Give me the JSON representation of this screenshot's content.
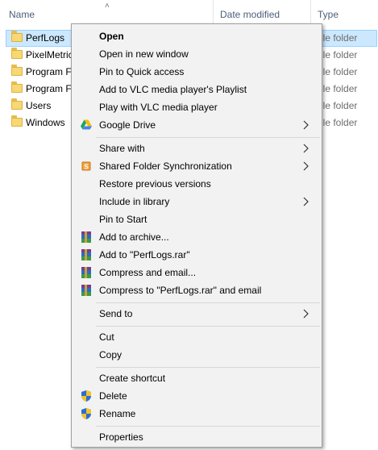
{
  "columns": {
    "name": "Name",
    "date": "Date modified",
    "type": "Type"
  },
  "files": [
    {
      "name": "PerfLogs",
      "type": "ile folder",
      "selected": true
    },
    {
      "name": "PixelMetric",
      "type": "ile folder"
    },
    {
      "name": "Program F",
      "type": "ile folder"
    },
    {
      "name": "Program F",
      "type": "ile folder"
    },
    {
      "name": "Users",
      "type": "ile folder"
    },
    {
      "name": "Windows",
      "type": "ile folder"
    }
  ],
  "menu": {
    "open": "Open",
    "open_new_window": "Open in new window",
    "pin_quick_access": "Pin to Quick access",
    "add_vlc_playlist": "Add to VLC media player's Playlist",
    "play_vlc": "Play with VLC media player",
    "google_drive": "Google Drive",
    "share_with": "Share with",
    "shared_folder_sync": "Shared Folder Synchronization",
    "restore_versions": "Restore previous versions",
    "include_library": "Include in library",
    "pin_start": "Pin to Start",
    "add_archive": "Add to archive...",
    "add_rar": "Add to \"PerfLogs.rar\"",
    "compress_email": "Compress and email...",
    "compress_rar_email": "Compress to \"PerfLogs.rar\" and email",
    "send_to": "Send to",
    "cut": "Cut",
    "copy": "Copy",
    "create_shortcut": "Create shortcut",
    "delete": "Delete",
    "rename": "Rename",
    "properties": "Properties"
  },
  "colors": {
    "menu_bg": "#f2f2f2",
    "selection": "#cce8ff",
    "folder": "#f8d775"
  }
}
